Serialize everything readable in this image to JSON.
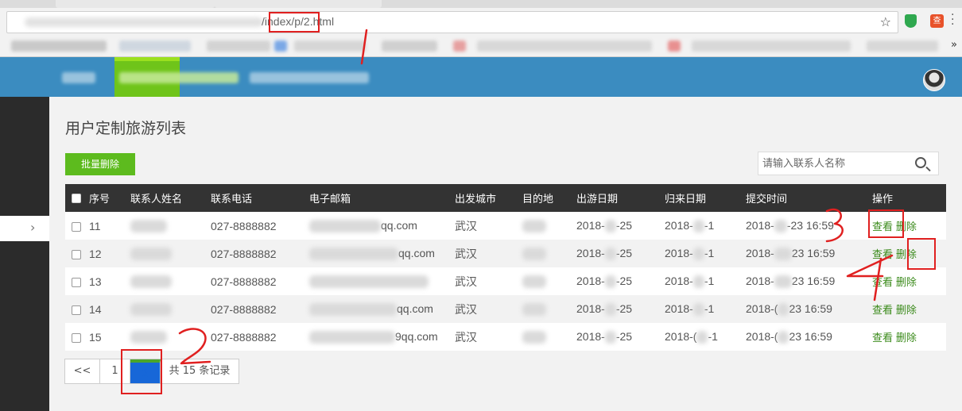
{
  "browser": {
    "url": "/index/p/2.html",
    "star_icon": "star-icon",
    "extension_icons": [
      "shield-extension-icon",
      "search-extension-icon"
    ],
    "extension_labels": [
      "",
      "查"
    ],
    "bookmarks_more": "»"
  },
  "header": {
    "avatar": "avatar"
  },
  "page": {
    "title": "用户定制旅游列表",
    "batch_delete": "批量删除",
    "search_placeholder": "请输入联系人名称"
  },
  "table": {
    "columns": [
      "序号",
      "联系人姓名",
      "联系电话",
      "电子邮箱",
      "出发城市",
      "目的地",
      "出游日期",
      "归来日期",
      "提交时间",
      "操作"
    ],
    "rows": [
      {
        "id": "11",
        "phone": "027-8888882",
        "email_tail": "qq.com",
        "city": "武汉",
        "start": "2018-",
        "start_tail": "-25",
        "back": "2018-",
        "back_tail": "-1",
        "submitted": "2018-",
        "submitted_tail": "-23 16:59",
        "view": "查看",
        "del": "删除"
      },
      {
        "id": "12",
        "phone": "027-8888882",
        "email_tail": "qq.com",
        "city": "武汉",
        "start": "2018-",
        "start_tail": "-25",
        "back": "2018-",
        "back_tail": "-1",
        "submitted": "2018-",
        "submitted_tail": "23 16:59",
        "view": "查看",
        "del": "删除"
      },
      {
        "id": "13",
        "phone": "027-8888882",
        "email_tail": "",
        "city": "武汉",
        "start": "2018-",
        "start_tail": "-25",
        "back": "2018-",
        "back_tail": "-1",
        "submitted": "2018-",
        "submitted_tail": "23 16:59",
        "view": "查看",
        "del": "删除"
      },
      {
        "id": "14",
        "phone": "027-8888882",
        "email_tail": "qq.com",
        "city": "武汉",
        "start": "2018-",
        "start_tail": "-25",
        "back": "2018-",
        "back_tail": "-1",
        "submitted": "2018-(",
        "submitted_tail": "23 16:59",
        "view": "查看",
        "del": "删除"
      },
      {
        "id": "15",
        "phone": "027-8888882",
        "email_tail": "9qq.com",
        "city": "武汉",
        "start": "2018-",
        "start_tail": "-25",
        "back": "2018-(",
        "back_tail": "-1",
        "submitted": "2018-(",
        "submitted_tail": "23 16:59",
        "view": "查看",
        "del": "删除"
      }
    ]
  },
  "pagination": {
    "prev": "<<",
    "pages": [
      "1",
      "2"
    ],
    "current": "2",
    "total": "共 15 条记录"
  },
  "sidebar": {
    "toggle": "›"
  },
  "annotations": [
    "1",
    "2",
    "3",
    "4"
  ]
}
